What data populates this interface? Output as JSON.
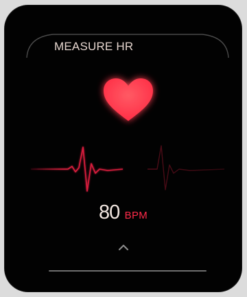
{
  "screen": {
    "title": "MEASURE HR"
  },
  "reading": {
    "value": "80",
    "unit": "BPM"
  },
  "icons": {
    "heart": "heart-icon",
    "expand": "chevron-up-icon"
  },
  "colors": {
    "accent": "#ff2b4a",
    "heart": "#ff3b4e",
    "ecg_bright": "#d81b3a",
    "ecg_dim": "#5a0d1a",
    "text": "#e6d6cf",
    "background": "#020202"
  }
}
